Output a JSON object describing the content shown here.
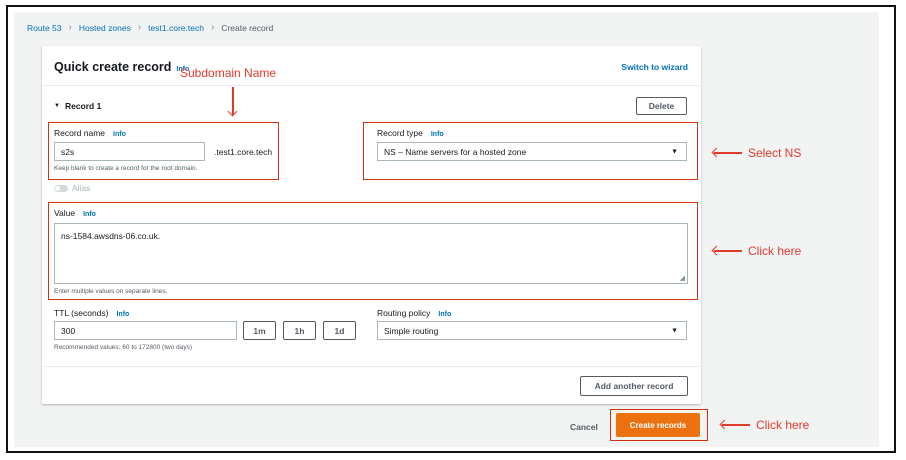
{
  "breadcrumb": {
    "items": [
      "Route 53",
      "Hosted zones",
      "test1.core.tech"
    ],
    "current": "Create record",
    "separator": ">"
  },
  "card": {
    "title": "Quick create record",
    "title_info": "Info",
    "switch_link": "Switch to wizard"
  },
  "record": {
    "heading": "Record 1",
    "delete_label": "Delete",
    "name_label": "Record name",
    "name_info": "Info",
    "name_value": "s2s",
    "domain_suffix": ".test1.core.tech",
    "name_hint": "Keep blank to create a record for the root domain.",
    "type_label": "Record type",
    "type_info": "Info",
    "type_value": "NS – Name servers for a hosted zone",
    "alias_label": "Alias",
    "value_label": "Value",
    "value_info": "Info",
    "value_text": "ns-1584.awsdns-06.co.uk.",
    "value_hint": "Enter multiple values on separate lines.",
    "ttl_label": "TTL (seconds)",
    "ttl_info": "Info",
    "ttl_value": "300",
    "ttl_buttons": [
      "1m",
      "1h",
      "1d"
    ],
    "ttl_hint": "Recommended values: 60 to 172800 (two days)",
    "routing_label": "Routing policy",
    "routing_info": "Info",
    "routing_value": "Simple routing",
    "add_another_label": "Add another record"
  },
  "footer": {
    "cancel_label": "Cancel",
    "create_label": "Create records"
  },
  "annotations": {
    "subdomain": "Subdomain Name",
    "select_ns": "Select NS",
    "click_here_value": "Click here",
    "click_here_create": "Click here"
  },
  "colors": {
    "link": "#0073bb",
    "primary_button": "#ec7211",
    "annotation": "#e03a2c",
    "console_background": "#f2f3f3"
  },
  "icons": {
    "breadcrumb_separator": "chevron-right-icon",
    "record_toggle": "caret-down-icon",
    "select_dropdown": "caret-down-icon",
    "annotation_arrow": "arrow-left-icon"
  }
}
